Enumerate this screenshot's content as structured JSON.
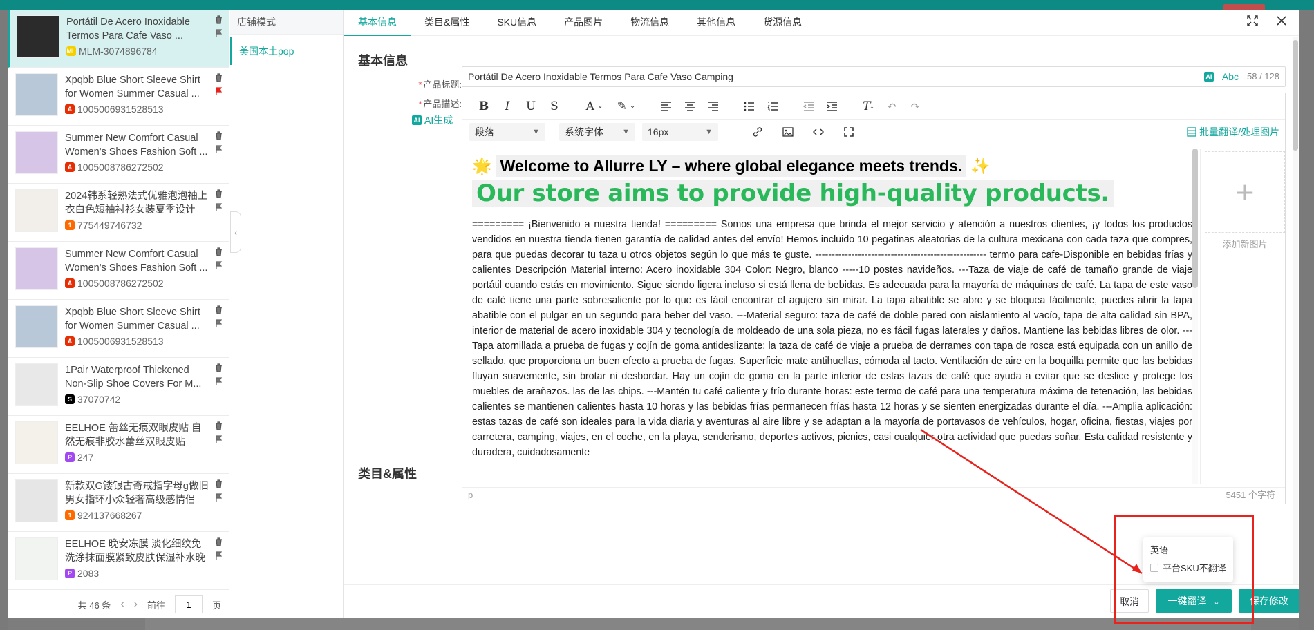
{
  "products": [
    {
      "title": "Portátil De Acero Inoxidable Termos Para Cafe Vaso ...",
      "id": "MLM-3074896784",
      "platform": "ml",
      "platform_icon": "mercadolibre-icon",
      "flagged": false,
      "active": true
    },
    {
      "title": "Xpqbb Blue Short Sleeve Shirt for Women Summer Casual ...",
      "id": "1005006931528513",
      "platform": "ae",
      "platform_icon": "aliexpress-icon",
      "flagged": true,
      "active": false
    },
    {
      "title": "Summer New Comfort Casual Women's Shoes Fashion Soft ...",
      "id": "1005008786272502",
      "platform": "ae",
      "platform_icon": "aliexpress-icon",
      "flagged": false,
      "active": false
    },
    {
      "title": "2024韩系轻熟法式优雅泡泡袖上衣白色短袖衬衫女装夏季设计感...",
      "id": "775449746732",
      "platform": "1688",
      "platform_icon": "1688-icon",
      "flagged": false,
      "active": false
    },
    {
      "title": "Summer New Comfort Casual Women's Shoes Fashion Soft ...",
      "id": "1005008786272502",
      "platform": "ae",
      "platform_icon": "aliexpress-icon",
      "flagged": false,
      "active": false
    },
    {
      "title": "Xpqbb Blue Short Sleeve Shirt for Women Summer Casual ...",
      "id": "1005006931528513",
      "platform": "ae",
      "platform_icon": "aliexpress-icon",
      "flagged": false,
      "active": false
    },
    {
      "title": "1Pair Waterproof Thickened Non-Slip Shoe Covers For M...",
      "id": "37070742",
      "platform": "shein",
      "platform_icon": "shein-icon",
      "flagged": false,
      "active": false
    },
    {
      "title": "EELHOE 蕾丝无痕双眼皮贴 自然无痕非胶水蕾丝双眼皮贴",
      "id": "247",
      "platform": "pdd",
      "platform_icon": "pinduoduo-icon",
      "flagged": false,
      "active": false
    },
    {
      "title": "新款双G镂银古奇戒指字母g做旧男女指环小众轻奢高级感情侣对...",
      "id": "924137668267",
      "platform": "1688",
      "platform_icon": "1688-icon",
      "flagged": false,
      "active": false
    },
    {
      "title": "EELHOE 晚安冻膜 淡化细纹免洗涂抹面膜紧致皮肤保湿补水晚霜",
      "id": "2083",
      "platform": "pdd",
      "platform_icon": "pinduoduo-icon",
      "flagged": false,
      "active": false
    }
  ],
  "pager": {
    "total": "共 46 条",
    "goto": "前往",
    "page": "1",
    "unit": "页"
  },
  "store": {
    "header": "店铺模式",
    "item": "美国本土pop"
  },
  "tabs": [
    "基本信息",
    "类目&属性",
    "SKU信息",
    "产品图片",
    "物流信息",
    "其他信息",
    "货源信息"
  ],
  "form": {
    "section_basic": "基本信息",
    "title_label": "产品标题:",
    "title_value": "Portátil De Acero Inoxidable Termos Para Cafe Vaso Camping",
    "title_ai": "AI",
    "title_abc": "Abc",
    "title_counter": "58 / 128",
    "desc_label": "产品描述:",
    "ai_generate": "AI生成",
    "section_category": "类目&属性"
  },
  "editor": {
    "paragraph_select": "段落",
    "font_select": "系统字体",
    "size_select": "16px",
    "batch_translate": "批量翻译/处理图片",
    "welcome_emoji": "🌟",
    "welcome": "Welcome to Allurre LY – where global elegance meets trends.",
    "sparkle_emoji": "✨",
    "headline": "Our store aims to provide high-quality products.",
    "body": "========= ¡Bienvenido a nuestra tienda! ========= Somos una empresa que brinda el mejor servicio y atención a nuestros clientes, ¡y todos los productos vendidos en nuestra tienda tienen garantía de calidad antes del envío! Hemos incluido 10 pegatinas aleatorias de la cultura mexicana con cada taza que compres, para que puedas decorar tu taza u otros objetos según lo que más te guste. ---------------------------------------------------- termo para cafe-Disponible en bebidas frías y calientes Descripción Material interno: Acero inoxidable 304 Color: Negro, blanco -----10 postes navideños. ---Taza de viaje de café de tamaño grande de viaje portátil cuando estás en movimiento. Sigue siendo ligera incluso si está llena de bebidas. Es adecuada para la mayoría de máquinas de café. La tapa de este vaso de café tiene una parte sobresaliente por lo que es fácil encontrar el agujero sin mirar. La tapa abatible se abre y se bloquea fácilmente, puedes abrir la tapa abatible con el pulgar en un segundo para beber del vaso. ---Material seguro: taza de café de doble pared con aislamiento al vacío, tapa de alta calidad sin BPA, interior de material de acero inoxidable 304 y tecnología de moldeado de una sola pieza, no es fácil fugas laterales y daños. Mantiene las bebidas libres de olor. ---Tapa atornillada a prueba de fugas y cojín de goma antideslizante: la taza de café de viaje a prueba de derrames con tapa de rosca está equipada con un anillo de sellado, que proporciona un buen efecto a prueba de fugas. Superficie mate antihuellas, cómoda al tacto. Ventilación de aire en la boquilla permite que las bebidas fluyan suavemente, sin brotar ni desbordar. Hay un cojín de goma en la parte inferior de estas tazas de café que ayuda a evitar que se deslice y protege los muebles de arañazos. las de las chips. ---Mantén tu café caliente y frío durante horas: este termo de café para una temperatura máxima de tetenación, las bebidas calientes se mantienen calientes hasta 10 horas y las bebidas frías permanecen frías hasta 12 horas y se sienten energizadas durante el día. ---Amplia aplicación: estas tazas de café son ideales para la vida diaria y aventuras al aire libre y se adaptan a la mayoría de portavasos de vehículos, hogar, oficina, fiestas, viajes por carretera, camping, viajes, en el coche, en la playa, senderismo, deportes activos, picnics, casi cualquier otra actividad que puedas soñar. Esta calidad resistente y duradera, cuidadosamente",
    "add_image": "添加新图片",
    "status_path": "p",
    "word_count": "5451 个字符"
  },
  "buttons": {
    "cancel": "取消",
    "translate": "一键翻译",
    "save": "保存修改"
  },
  "dropdown": {
    "option": "英语",
    "checkbox_label": "平台SKU不翻译"
  },
  "colors": {
    "accent": "#13a89e",
    "annotation": "#e8231d",
    "headline_green": "#2ab95a"
  }
}
